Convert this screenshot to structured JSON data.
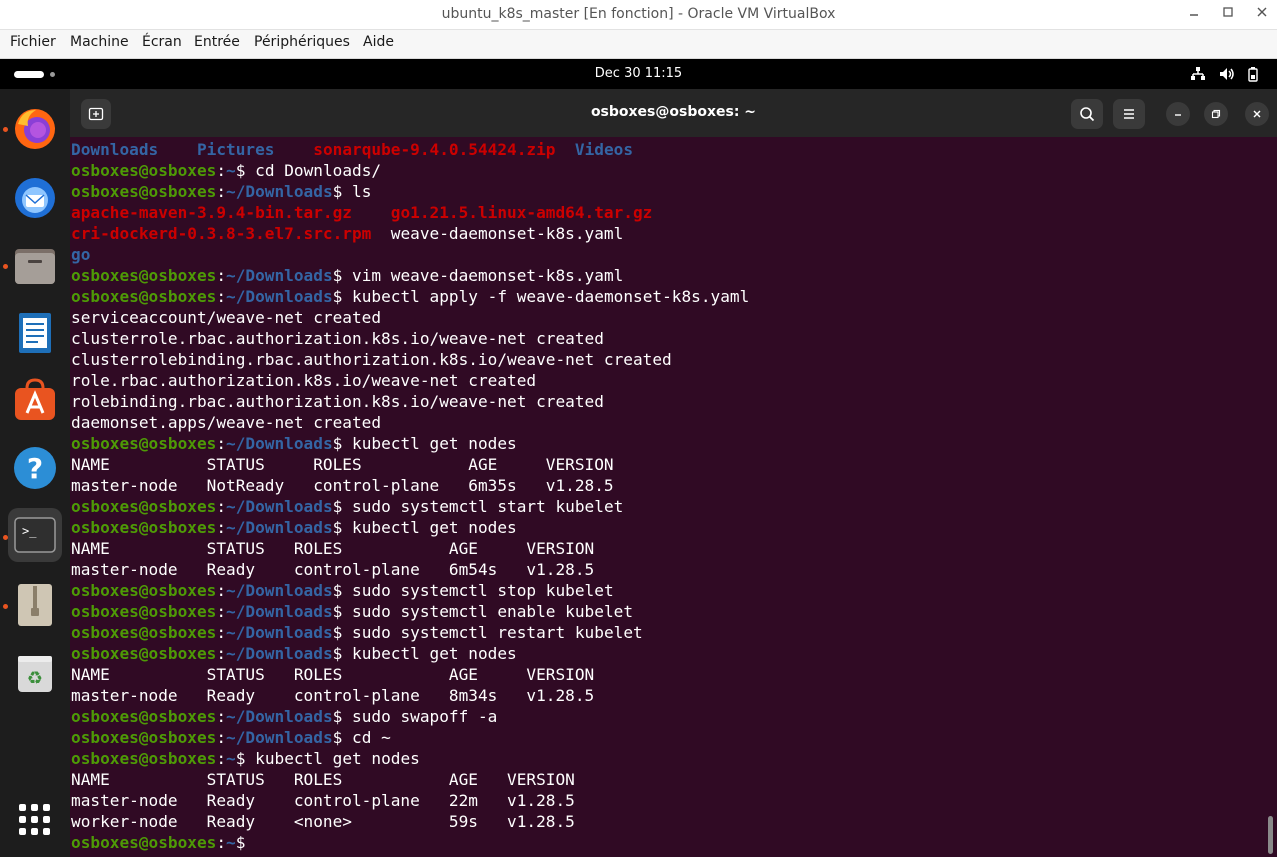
{
  "vbox": {
    "title": "ubuntu_k8s_master [En fonction] - Oracle VM VirtualBox",
    "menu": [
      "Fichier",
      "Machine",
      "Écran",
      "Entrée",
      "Périphériques",
      "Aide"
    ]
  },
  "topbar": {
    "clock": "Dec 30  11:15"
  },
  "dock": {
    "items": [
      "firefox-icon",
      "thunderbird-icon",
      "files-icon",
      "libreoffice-writer-icon",
      "app-center-icon",
      "help-icon",
      "terminal-icon",
      "archive-icon",
      "trash-icon",
      "show-apps-icon"
    ]
  },
  "terminal": {
    "title": "osboxes@osboxes: ~",
    "user_host": "osboxes@osboxes",
    "lines": [
      [
        [
          "dir",
          "Downloads"
        ],
        [
          "t",
          "    "
        ],
        [
          "dir",
          "Pictures"
        ],
        [
          "t",
          "    "
        ],
        [
          "arc",
          "sonarqube-9.4.0.54424.zip"
        ],
        [
          "t",
          "  "
        ],
        [
          "dir",
          "Videos"
        ]
      ],
      [
        [
          "u",
          "osboxes@osboxes"
        ],
        [
          "t",
          ":"
        ],
        [
          "p",
          "~"
        ],
        [
          "t",
          "$ cd Downloads/"
        ]
      ],
      [
        [
          "u",
          "osboxes@osboxes"
        ],
        [
          "t",
          ":"
        ],
        [
          "p",
          "~/Downloads"
        ],
        [
          "t",
          "$ ls"
        ]
      ],
      [
        [
          "arc",
          "apache-maven-3.9.4-bin.tar.gz"
        ],
        [
          "t",
          "    "
        ],
        [
          "arc",
          "go1.21.5.linux-amd64.tar.gz"
        ]
      ],
      [
        [
          "arc",
          "cri-dockerd-0.3.8-3.el7.src.rpm"
        ],
        [
          "t",
          "  weave-daemonset-k8s.yaml"
        ]
      ],
      [
        [
          "dir",
          "go"
        ]
      ],
      [
        [
          "u",
          "osboxes@osboxes"
        ],
        [
          "t",
          ":"
        ],
        [
          "p",
          "~/Downloads"
        ],
        [
          "t",
          "$ vim weave-daemonset-k8s.yaml"
        ]
      ],
      [
        [
          "u",
          "osboxes@osboxes"
        ],
        [
          "t",
          ":"
        ],
        [
          "p",
          "~/Downloads"
        ],
        [
          "t",
          "$ kubectl apply -f weave-daemonset-k8s.yaml"
        ]
      ],
      [
        [
          "t",
          "serviceaccount/weave-net created"
        ]
      ],
      [
        [
          "t",
          "clusterrole.rbac.authorization.k8s.io/weave-net created"
        ]
      ],
      [
        [
          "t",
          "clusterrolebinding.rbac.authorization.k8s.io/weave-net created"
        ]
      ],
      [
        [
          "t",
          "role.rbac.authorization.k8s.io/weave-net created"
        ]
      ],
      [
        [
          "t",
          "rolebinding.rbac.authorization.k8s.io/weave-net created"
        ]
      ],
      [
        [
          "t",
          "daemonset.apps/weave-net created"
        ]
      ],
      [
        [
          "u",
          "osboxes@osboxes"
        ],
        [
          "t",
          ":"
        ],
        [
          "p",
          "~/Downloads"
        ],
        [
          "t",
          "$ kubectl get nodes"
        ]
      ],
      [
        [
          "t",
          "NAME          STATUS     ROLES           AGE     VERSION"
        ]
      ],
      [
        [
          "t",
          "master-node   NotReady   control-plane   6m35s   v1.28.5"
        ]
      ],
      [
        [
          "u",
          "osboxes@osboxes"
        ],
        [
          "t",
          ":"
        ],
        [
          "p",
          "~/Downloads"
        ],
        [
          "t",
          "$ sudo systemctl start kubelet"
        ]
      ],
      [
        [
          "u",
          "osboxes@osboxes"
        ],
        [
          "t",
          ":"
        ],
        [
          "p",
          "~/Downloads"
        ],
        [
          "t",
          "$ kubectl get nodes"
        ]
      ],
      [
        [
          "t",
          "NAME          STATUS   ROLES           AGE     VERSION"
        ]
      ],
      [
        [
          "t",
          "master-node   Ready    control-plane   6m54s   v1.28.5"
        ]
      ],
      [
        [
          "u",
          "osboxes@osboxes"
        ],
        [
          "t",
          ":"
        ],
        [
          "p",
          "~/Downloads"
        ],
        [
          "t",
          "$ sudo systemctl stop kubelet"
        ]
      ],
      [
        [
          "u",
          "osboxes@osboxes"
        ],
        [
          "t",
          ":"
        ],
        [
          "p",
          "~/Downloads"
        ],
        [
          "t",
          "$ sudo systemctl enable kubelet"
        ]
      ],
      [
        [
          "u",
          "osboxes@osboxes"
        ],
        [
          "t",
          ":"
        ],
        [
          "p",
          "~/Downloads"
        ],
        [
          "t",
          "$ sudo systemctl restart kubelet"
        ]
      ],
      [
        [
          "u",
          "osboxes@osboxes"
        ],
        [
          "t",
          ":"
        ],
        [
          "p",
          "~/Downloads"
        ],
        [
          "t",
          "$ kubectl get nodes"
        ]
      ],
      [
        [
          "t",
          "NAME          STATUS   ROLES           AGE     VERSION"
        ]
      ],
      [
        [
          "t",
          "master-node   Ready    control-plane   8m34s   v1.28.5"
        ]
      ],
      [
        [
          "u",
          "osboxes@osboxes"
        ],
        [
          "t",
          ":"
        ],
        [
          "p",
          "~/Downloads"
        ],
        [
          "t",
          "$ sudo swapoff -a"
        ]
      ],
      [
        [
          "u",
          "osboxes@osboxes"
        ],
        [
          "t",
          ":"
        ],
        [
          "p",
          "~/Downloads"
        ],
        [
          "t",
          "$ cd ~"
        ]
      ],
      [
        [
          "u",
          "osboxes@osboxes"
        ],
        [
          "t",
          ":"
        ],
        [
          "p",
          "~"
        ],
        [
          "t",
          "$ kubectl get nodes"
        ]
      ],
      [
        [
          "t",
          "NAME          STATUS   ROLES           AGE   VERSION"
        ]
      ],
      [
        [
          "t",
          "master-node   Ready    control-plane   22m   v1.28.5"
        ]
      ],
      [
        [
          "t",
          "worker-node   Ready    <none>          59s   v1.28.5"
        ]
      ],
      [
        [
          "u",
          "osboxes@osboxes"
        ],
        [
          "t",
          ":"
        ],
        [
          "p",
          "~"
        ],
        [
          "t",
          "$ "
        ]
      ]
    ]
  }
}
